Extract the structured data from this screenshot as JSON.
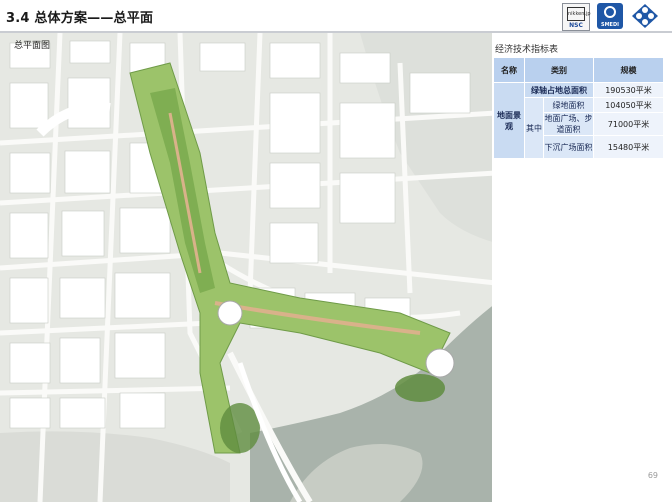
{
  "header": {
    "title": "3.4 总体方案——总平面",
    "logos": [
      {
        "name": "nsc-logo",
        "text": "NSC",
        "box": "nikken.jp"
      },
      {
        "name": "smedi-logo",
        "text": "SMEDI"
      },
      {
        "name": "diamond-logo"
      }
    ]
  },
  "map": {
    "label": "总平面图",
    "colors": {
      "water": "#a9b3ab",
      "land": "#e6e8e3",
      "road": "#fafaf8",
      "building": "#ffffff",
      "green": "#9cc36a",
      "dark_green": "#5f8c3e",
      "plaza": "#d9b28a"
    }
  },
  "table": {
    "title": "经济技术指标表",
    "headers": [
      "名称",
      "类别",
      "规模"
    ],
    "group_name": "地面景观",
    "sub_group": "其中",
    "rows": [
      {
        "category": "绿轴占地总面积",
        "value": "190530平米"
      },
      {
        "category": "绿地面积",
        "value": "104050平米"
      },
      {
        "category": "地面广场、步道面积",
        "value": "71000平米"
      },
      {
        "category": "下沉广场面积",
        "value": "15480平米"
      }
    ]
  },
  "page_number": "69"
}
